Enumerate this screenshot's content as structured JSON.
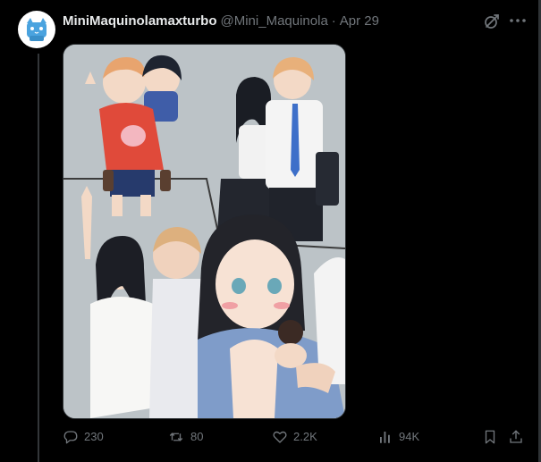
{
  "post": {
    "display_name": "MiniMaquinolamaxturbo",
    "handle": "@Mini_Maquinola",
    "separator": "·",
    "time": "Apr 29",
    "media": {
      "icon": "illustration-image",
      "panels": [
        "children-piggyback-panel",
        "school-couple-panel",
        "wedding-panel",
        "newborn-baby-panel"
      ]
    }
  },
  "actions": {
    "reply": {
      "icon": "reply-icon",
      "count": "230"
    },
    "repost": {
      "icon": "repost-icon",
      "count": "80"
    },
    "like": {
      "icon": "like-icon",
      "count": "2.2K"
    },
    "views": {
      "icon": "views-icon",
      "count": "94K"
    },
    "bookmark": {
      "icon": "bookmark-icon"
    },
    "share": {
      "icon": "share-icon"
    }
  },
  "colors": {
    "background": "#000000",
    "text_primary": "#e7e9ea",
    "text_secondary": "#71767b",
    "border": "#2f3336",
    "avatar_blue": "#4aa3df"
  }
}
